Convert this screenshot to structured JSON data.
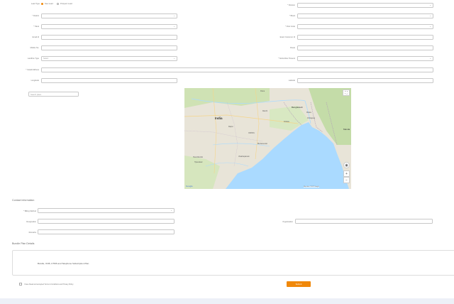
{
  "lead_type": {
    "label": "Lead Type",
    "options": [
      "New Lead",
      "Prospect Lead"
    ],
    "selected": 0
  },
  "left_fields": [
    {
      "label": "* District",
      "value": "",
      "type": "select"
    },
    {
      "label": "* Taluk",
      "value": "",
      "type": "select"
    },
    {
      "label": "Email Id",
      "value": "",
      "type": "text"
    },
    {
      "label": "Mobile No.",
      "value": "",
      "type": "text"
    },
    {
      "label": "Landline Type",
      "value": "Select",
      "type": "select"
    }
  ],
  "right_fields": [
    {
      "label": "* Division",
      "value": "",
      "type": "select"
    },
    {
      "label": "* Block",
      "value": "",
      "type": "select"
    },
    {
      "label": "* Post Code",
      "value": "",
      "type": "select"
    },
    {
      "label": "Exact Customer Id",
      "value": "",
      "type": "text"
    },
    {
      "label": "Route",
      "value": "",
      "type": "text"
    },
    {
      "label": "* Subscriber Present",
      "value": "",
      "type": "select"
    }
  ],
  "install_address": {
    "label": "* Install Address",
    "value": ""
  },
  "longitude": {
    "label": "Longitude",
    "value": ""
  },
  "latitude": {
    "label": "Latitude",
    "value": ""
  },
  "map_search": {
    "placeholder": "Search place"
  },
  "map": {
    "labels": {
      "india": "India",
      "bangladesh": "Bangladesh",
      "kolkata": "Kolkata",
      "raipur": "Raipur",
      "patna": "Patna",
      "ranchi": "Ranchi",
      "dhaka": "Dhaka",
      "chittagong": "Chittagong",
      "hyderabad": "Hyderabad",
      "visakhapatnam": "Visakhapatnam",
      "bhubaneswar": "Bhubaneswar",
      "mandalay": "Manda",
      "odisha": "ODISHA",
      "telangana": "TELANGANA",
      "google": "Google",
      "attribution": "Map data ©2022 Google"
    },
    "zoom_in": "+",
    "zoom_out": "−",
    "fullscreen_icon": "⛶"
  },
  "contact": {
    "title": "Contact Information",
    "fields": [
      {
        "label": "* Billing Method",
        "value": "",
        "type": "select"
      },
      {
        "label": "Designation",
        "value": "",
        "type": "text"
      },
      {
        "label": "Remarks",
        "value": "",
        "type": "text"
      }
    ],
    "organisation": {
      "label": "Organisation",
      "value": ""
    }
  },
  "bundle": {
    "title": "Bundle Plan Details",
    "text": "Bundle, OCB, UTMS and Telephone Subscription Plan"
  },
  "terms": {
    "label": "I have Read and accepted Terms & Conditions and Privacy Policy"
  },
  "submit": {
    "label": "Submit"
  },
  "colors": {
    "accent": "#f0880a",
    "water": "#aadaff",
    "land": "#e8e4d8",
    "green": "#c8dfb0"
  }
}
